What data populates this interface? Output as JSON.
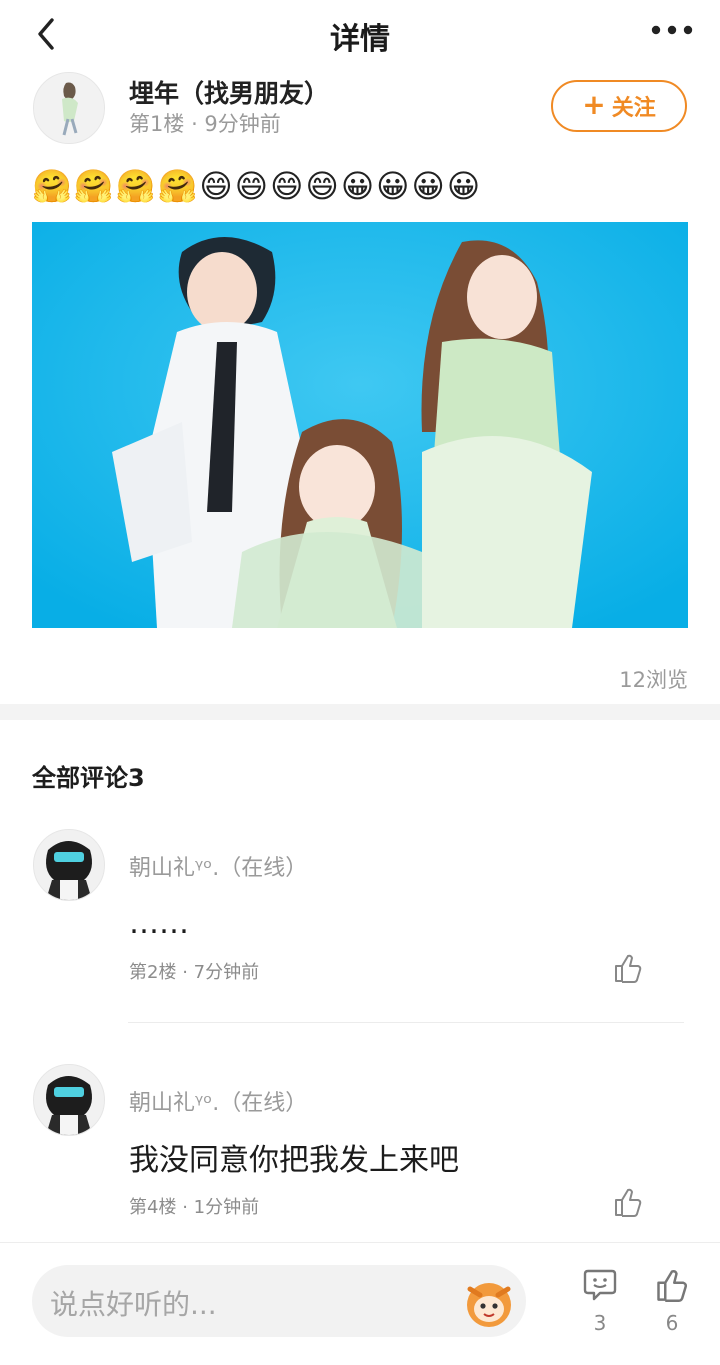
{
  "header": {
    "title": "详情"
  },
  "post": {
    "author": "埋年（找男朋友）",
    "floor": "第1楼",
    "time": "9分钟前",
    "follow_label": "关注",
    "emoji_text": "🤗🤗🤗🤗😄😄😄😄😀😀😀😀",
    "views": "12浏览"
  },
  "comments_section": {
    "title": "全部评论3",
    "comments": [
      {
        "name": "朝山礼ᵞᵒ.（在线）",
        "text": "……",
        "floor": "第2楼",
        "time": "7分钟前"
      },
      {
        "name": "朝山礼ᵞᵒ.（在线）",
        "text": "我没同意你把我发上来吧",
        "floor": "第4楼",
        "time": "1分钟前"
      }
    ]
  },
  "bottom_bar": {
    "input_placeholder": "说点好听的...",
    "comment_count": "3",
    "like_count": "6"
  },
  "colors": {
    "accent": "#f08a24",
    "photo_bg": "#10b4ea"
  }
}
